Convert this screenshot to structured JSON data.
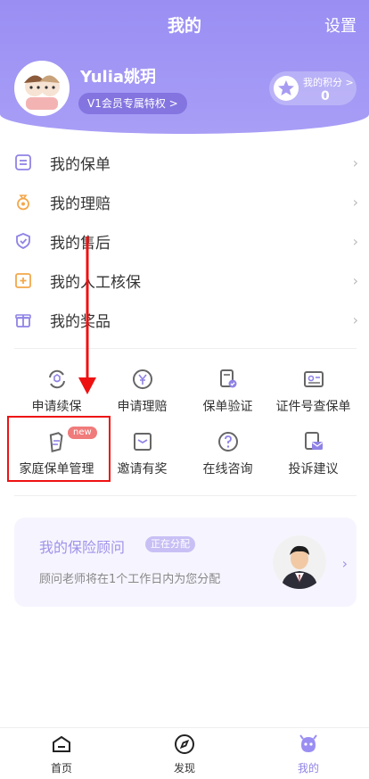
{
  "header": {
    "title": "我的",
    "settings_label": "设置",
    "username": "Yulia姚玥",
    "vip_label": "V1会员专属特权 >",
    "points_label": "我的积分 >",
    "points_value": "0"
  },
  "menu": [
    {
      "label": "我的保单",
      "icon": "policy-doc-icon"
    },
    {
      "label": "我的理赔",
      "icon": "money-bag-icon"
    },
    {
      "label": "我的售后",
      "icon": "shield-check-icon"
    },
    {
      "label": "我的人工核保",
      "icon": "calendar-plus-icon"
    },
    {
      "label": "我的奖品",
      "icon": "gift-icon"
    }
  ],
  "grid": [
    {
      "label": "申请续保",
      "icon": "renew-icon"
    },
    {
      "label": "申请理赔",
      "icon": "yen-circle-icon"
    },
    {
      "label": "保单验证",
      "icon": "verify-doc-icon"
    },
    {
      "label": "证件号查保单",
      "icon": "id-card-icon"
    },
    {
      "label": "家庭保单管理",
      "icon": "family-policy-icon",
      "badge": "new"
    },
    {
      "label": "邀请有奖",
      "icon": "invite-envelope-icon"
    },
    {
      "label": "在线咨询",
      "icon": "question-circle-icon"
    },
    {
      "label": "投诉建议",
      "icon": "complaint-mail-icon"
    }
  ],
  "advisor": {
    "title": "我的保险顾问",
    "status": "正在分配",
    "subtitle": "顾问老师将在1个工作日内为您分配"
  },
  "bottom_nav": [
    {
      "label": "首页",
      "icon": "home-icon"
    },
    {
      "label": "发现",
      "icon": "compass-icon"
    },
    {
      "label": "我的",
      "icon": "profile-face-icon"
    }
  ],
  "colors": {
    "accent": "#9a8ef3",
    "icon_purple": "#8f83e6",
    "icon_orange": "#f3a74a",
    "annotation_red": "#e11111"
  }
}
